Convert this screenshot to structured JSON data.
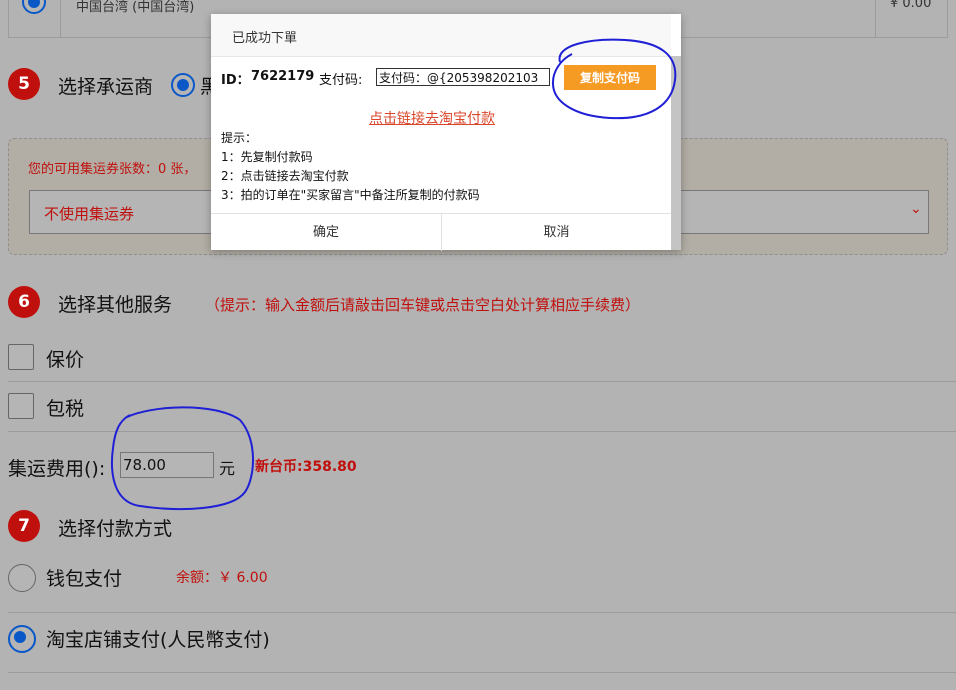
{
  "top_row": {
    "region": "中国台湾 (中国台湾)",
    "price": "¥ 0.00"
  },
  "step5": {
    "number": "5",
    "title": "选择承运商",
    "carrier_partial": "黑",
    "coupon_count_text": "您的可用集运券张数：0 张，",
    "coupon_select_value": "不使用集运券"
  },
  "step6": {
    "number": "6",
    "title": "选择其他服务",
    "hint": "（提示：输入金额后请敲击回车键或点击空白处计算相应手续费）",
    "insurance_label": "保价",
    "tax_label": "包税",
    "fee_label": "集运费用():",
    "fee_value": "78.00",
    "fee_unit": "元",
    "twd_label": "新台币:358.80"
  },
  "step7": {
    "number": "7",
    "title": "选择付款方式",
    "wallet_label": "钱包支付",
    "wallet_balance": "余额：￥ 6.00",
    "taobao_label": "淘宝店铺支付(人民幣支付)"
  },
  "dialog": {
    "title": "已成功下單",
    "id_label": "ID：",
    "id_value": "7622179",
    "pay_code_label": "支付码:",
    "pay_code_value": "支付码：@{205398202103",
    "copy_button": "复制支付码",
    "taobao_link": "点击链接去淘宝付款",
    "tips_title": "提示：",
    "tips": [
      "1：先复制付款码",
      "2：点击链接去淘宝付款",
      "3：拍的订单在\"买家留言\"中备注所复制的付款码"
    ],
    "confirm_button": "确定",
    "cancel_button": "取消"
  },
  "colors": {
    "overlay": "#b3b3b3",
    "accent_red": "#c0100d",
    "radio_blue": "#0a58c7",
    "copy_orange": "#f59a23",
    "annotation_blue": "#1f1fd6"
  }
}
